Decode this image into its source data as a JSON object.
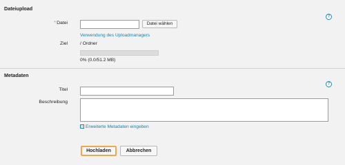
{
  "upload_section": {
    "title": "Dateiupload",
    "file_label": "Datei",
    "required_marker": "*",
    "file_value": "",
    "choose_file_button": "Datei wählen",
    "upload_manager_link": "Verwendung des Uploadmanagers",
    "target_label": "Ziel",
    "target_value": "/ Ordner",
    "progress_fraction": 0,
    "progress_text": "0% (0.0/51.2 MB)",
    "help_icon": "?"
  },
  "metadata_section": {
    "title": "Metadaten",
    "title_label": "Titel",
    "title_value": "",
    "description_label": "Beschreibung",
    "description_value": "",
    "extended_metadata_link": "Erweiterte Metadaten eingeben",
    "expand_icon": "+",
    "help_icon": "?"
  },
  "actions": {
    "upload_button": "Hochladen",
    "cancel_button": "Abbrechen"
  },
  "colors": {
    "accent_link": "#1b7fa8",
    "primary_border": "#f0a64b",
    "required": "#e08a1e",
    "background": "#f2f2f2"
  },
  "icons": {
    "help": "help-icon",
    "expand": "expand-plus-icon"
  }
}
